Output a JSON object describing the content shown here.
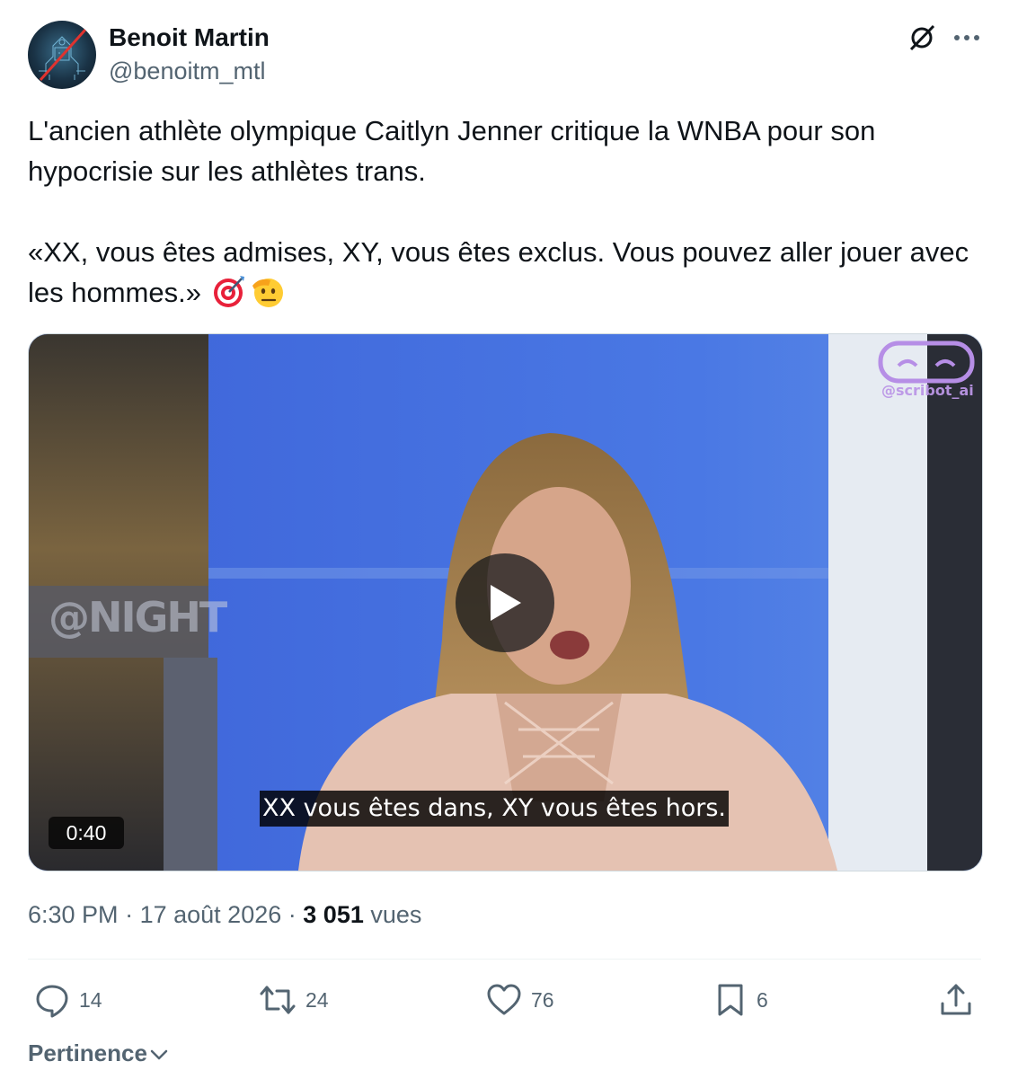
{
  "author": {
    "display_name": "Benoit Martin",
    "handle": "@benoitm_mtl",
    "avatar_icon": "robot-circuit-avatar"
  },
  "header_actions": {
    "grok_icon": "grok-icon",
    "more_icon": "more-dots-icon"
  },
  "tweet": {
    "paragraph_1": "L'ancien athlète olympique Caitlyn Jenner critique la WNBA pour son hypocrisie sur les athlètes trans.",
    "paragraph_2": "«XX, vous êtes admises, XY, vous êtes exclus. Vous pouvez aller jouer avec les hommes.»",
    "emojis": [
      "direct-hit-emoji",
      "saluting-face-emoji"
    ]
  },
  "media": {
    "subtitle": "XX vous êtes dans, XY vous êtes hors.",
    "duration": "0:40",
    "watermark": "@scribot_ai",
    "channel_logo": "@NIGHT",
    "play_icon": "play-icon"
  },
  "meta": {
    "time": "6:30 PM",
    "separator": "·",
    "date": "17 août 2026",
    "views_count": "3 051",
    "views_label": "vues"
  },
  "actions": {
    "replies": "14",
    "reposts": "24",
    "likes": "76",
    "bookmarks": "6"
  },
  "sort": {
    "label": "Pertinence"
  },
  "colors": {
    "text_primary": "#0f1419",
    "text_secondary": "#536471",
    "divider": "#eff3f4",
    "media_blue": "#3b5bd0"
  }
}
